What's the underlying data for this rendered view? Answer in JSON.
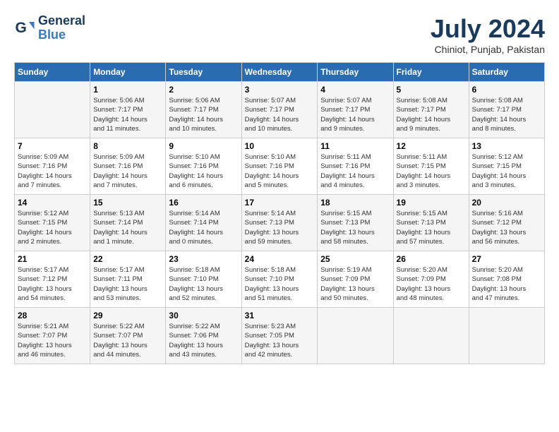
{
  "logo": {
    "line1": "General",
    "line2": "Blue"
  },
  "title": "July 2024",
  "location": "Chiniot, Punjab, Pakistan",
  "header_days": [
    "Sunday",
    "Monday",
    "Tuesday",
    "Wednesday",
    "Thursday",
    "Friday",
    "Saturday"
  ],
  "weeks": [
    [
      {
        "day": "",
        "info": ""
      },
      {
        "day": "1",
        "info": "Sunrise: 5:06 AM\nSunset: 7:17 PM\nDaylight: 14 hours\nand 11 minutes."
      },
      {
        "day": "2",
        "info": "Sunrise: 5:06 AM\nSunset: 7:17 PM\nDaylight: 14 hours\nand 10 minutes."
      },
      {
        "day": "3",
        "info": "Sunrise: 5:07 AM\nSunset: 7:17 PM\nDaylight: 14 hours\nand 10 minutes."
      },
      {
        "day": "4",
        "info": "Sunrise: 5:07 AM\nSunset: 7:17 PM\nDaylight: 14 hours\nand 9 minutes."
      },
      {
        "day": "5",
        "info": "Sunrise: 5:08 AM\nSunset: 7:17 PM\nDaylight: 14 hours\nand 9 minutes."
      },
      {
        "day": "6",
        "info": "Sunrise: 5:08 AM\nSunset: 7:17 PM\nDaylight: 14 hours\nand 8 minutes."
      }
    ],
    [
      {
        "day": "7",
        "info": "Sunrise: 5:09 AM\nSunset: 7:16 PM\nDaylight: 14 hours\nand 7 minutes."
      },
      {
        "day": "8",
        "info": "Sunrise: 5:09 AM\nSunset: 7:16 PM\nDaylight: 14 hours\nand 7 minutes."
      },
      {
        "day": "9",
        "info": "Sunrise: 5:10 AM\nSunset: 7:16 PM\nDaylight: 14 hours\nand 6 minutes."
      },
      {
        "day": "10",
        "info": "Sunrise: 5:10 AM\nSunset: 7:16 PM\nDaylight: 14 hours\nand 5 minutes."
      },
      {
        "day": "11",
        "info": "Sunrise: 5:11 AM\nSunset: 7:16 PM\nDaylight: 14 hours\nand 4 minutes."
      },
      {
        "day": "12",
        "info": "Sunrise: 5:11 AM\nSunset: 7:15 PM\nDaylight: 14 hours\nand 3 minutes."
      },
      {
        "day": "13",
        "info": "Sunrise: 5:12 AM\nSunset: 7:15 PM\nDaylight: 14 hours\nand 3 minutes."
      }
    ],
    [
      {
        "day": "14",
        "info": "Sunrise: 5:12 AM\nSunset: 7:15 PM\nDaylight: 14 hours\nand 2 minutes."
      },
      {
        "day": "15",
        "info": "Sunrise: 5:13 AM\nSunset: 7:14 PM\nDaylight: 14 hours\nand 1 minute."
      },
      {
        "day": "16",
        "info": "Sunrise: 5:14 AM\nSunset: 7:14 PM\nDaylight: 14 hours\nand 0 minutes."
      },
      {
        "day": "17",
        "info": "Sunrise: 5:14 AM\nSunset: 7:13 PM\nDaylight: 13 hours\nand 59 minutes."
      },
      {
        "day": "18",
        "info": "Sunrise: 5:15 AM\nSunset: 7:13 PM\nDaylight: 13 hours\nand 58 minutes."
      },
      {
        "day": "19",
        "info": "Sunrise: 5:15 AM\nSunset: 7:13 PM\nDaylight: 13 hours\nand 57 minutes."
      },
      {
        "day": "20",
        "info": "Sunrise: 5:16 AM\nSunset: 7:12 PM\nDaylight: 13 hours\nand 56 minutes."
      }
    ],
    [
      {
        "day": "21",
        "info": "Sunrise: 5:17 AM\nSunset: 7:12 PM\nDaylight: 13 hours\nand 54 minutes."
      },
      {
        "day": "22",
        "info": "Sunrise: 5:17 AM\nSunset: 7:11 PM\nDaylight: 13 hours\nand 53 minutes."
      },
      {
        "day": "23",
        "info": "Sunrise: 5:18 AM\nSunset: 7:10 PM\nDaylight: 13 hours\nand 52 minutes."
      },
      {
        "day": "24",
        "info": "Sunrise: 5:18 AM\nSunset: 7:10 PM\nDaylight: 13 hours\nand 51 minutes."
      },
      {
        "day": "25",
        "info": "Sunrise: 5:19 AM\nSunset: 7:09 PM\nDaylight: 13 hours\nand 50 minutes."
      },
      {
        "day": "26",
        "info": "Sunrise: 5:20 AM\nSunset: 7:09 PM\nDaylight: 13 hours\nand 48 minutes."
      },
      {
        "day": "27",
        "info": "Sunrise: 5:20 AM\nSunset: 7:08 PM\nDaylight: 13 hours\nand 47 minutes."
      }
    ],
    [
      {
        "day": "28",
        "info": "Sunrise: 5:21 AM\nSunset: 7:07 PM\nDaylight: 13 hours\nand 46 minutes."
      },
      {
        "day": "29",
        "info": "Sunrise: 5:22 AM\nSunset: 7:07 PM\nDaylight: 13 hours\nand 44 minutes."
      },
      {
        "day": "30",
        "info": "Sunrise: 5:22 AM\nSunset: 7:06 PM\nDaylight: 13 hours\nand 43 minutes."
      },
      {
        "day": "31",
        "info": "Sunrise: 5:23 AM\nSunset: 7:05 PM\nDaylight: 13 hours\nand 42 minutes."
      },
      {
        "day": "",
        "info": ""
      },
      {
        "day": "",
        "info": ""
      },
      {
        "day": "",
        "info": ""
      }
    ]
  ]
}
